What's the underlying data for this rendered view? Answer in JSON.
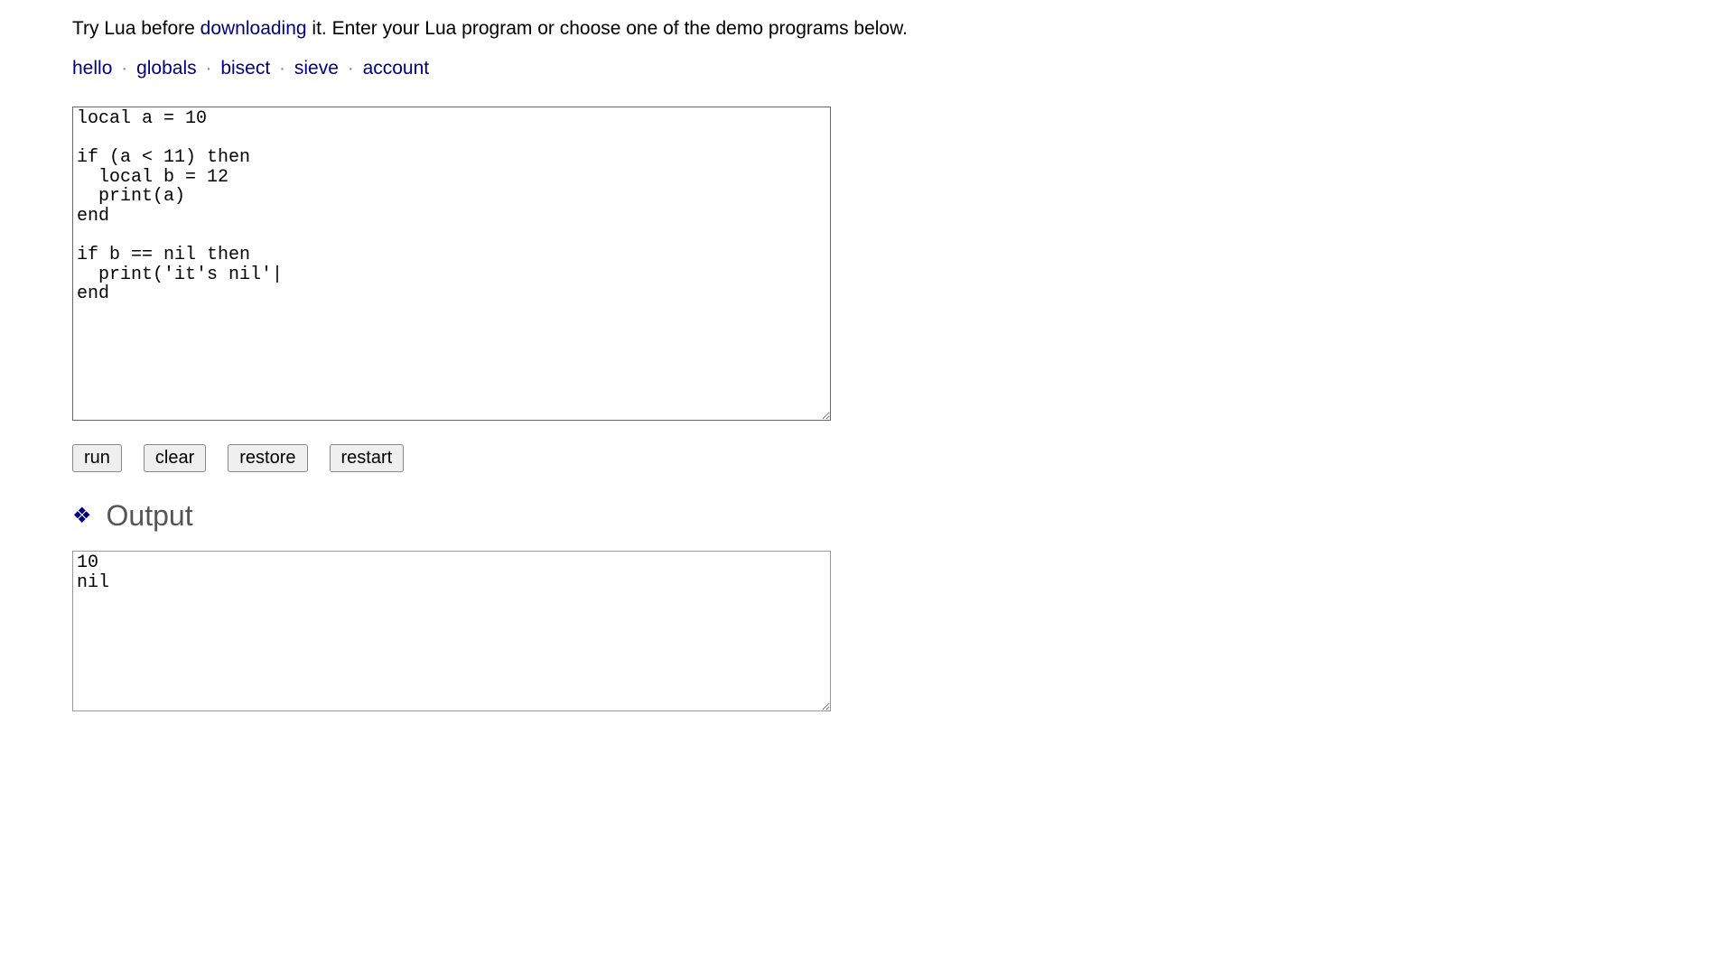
{
  "intro": {
    "prefix": "Try Lua before ",
    "link_text": "downloading",
    "suffix": " it. Enter your Lua program or choose one of the demo programs below."
  },
  "demos": {
    "hello": "hello",
    "globals": "globals",
    "bisect": "bisect",
    "sieve": "sieve",
    "account": "account"
  },
  "separator": "·",
  "code": "local a = 10\n\nif (a < 11) then\n  local b = 12\n  print(a)\nend\n\nif b == nil then\n  print('it's nil'|\nend",
  "buttons": {
    "run": "run",
    "clear": "clear",
    "restore": "restore",
    "restart": "restart"
  },
  "output_section": {
    "title": "Output"
  },
  "output": "10\nnil"
}
